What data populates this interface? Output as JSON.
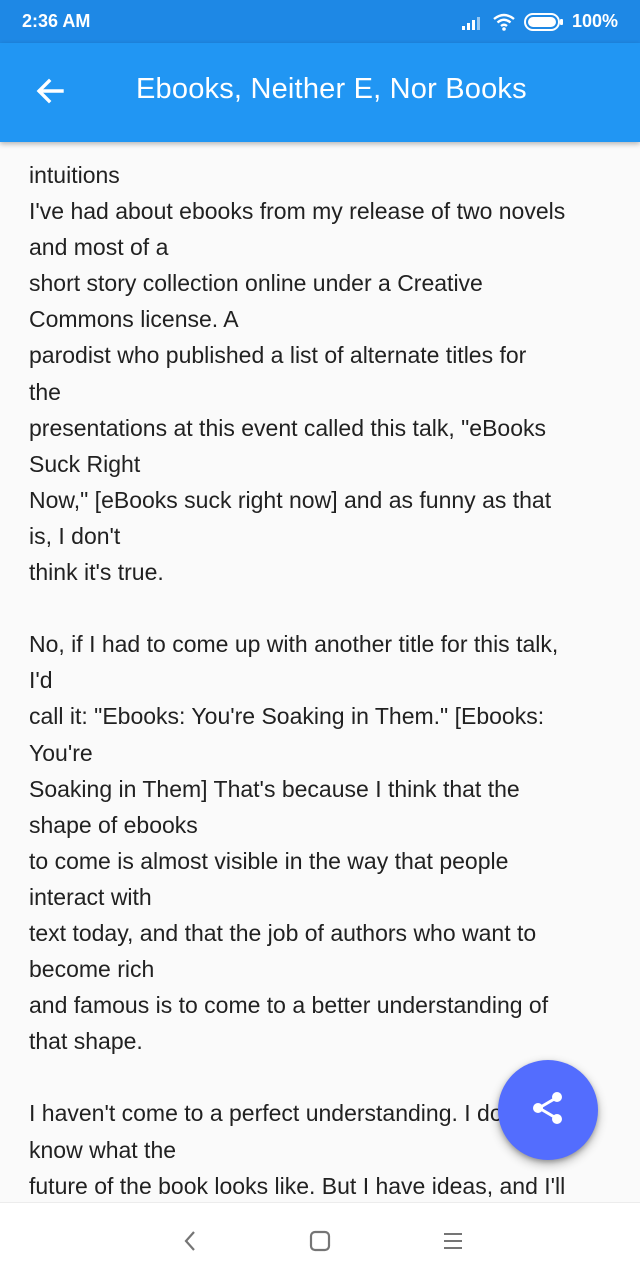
{
  "status_bar": {
    "time": "2:36 AM",
    "battery": "100%",
    "icons": [
      "signal-icon",
      "wifi-icon",
      "battery-icon"
    ]
  },
  "app_bar": {
    "title": "Ebooks, Neither E, Nor Books",
    "back_icon": "arrow-left-icon"
  },
  "article": {
    "lines": [
      "intuitions",
      "I've had about ebooks from my release of two novels",
      "and most of a",
      "short story collection online under a Creative",
      "Commons license. A",
      "parodist who published a list of alternate titles for",
      "the",
      "presentations at this event called this talk, \"eBooks",
      "Suck Right",
      "Now,\" [eBooks suck right now] and as funny as that",
      "is, I don't",
      "think it's true.",
      "",
      "No, if I had to come up with another title for this talk,",
      "I'd",
      "call it: \"Ebooks: You're Soaking in Them.\" [Ebooks:",
      "You're",
      "Soaking in Them] That's because I think that the",
      "shape of ebooks",
      "to come is almost visible in the way that people",
      "interact with",
      "text today, and that the job of authors who want to",
      "become rich",
      "and famous is to come to a better understanding of",
      "that shape.",
      "",
      "I haven't come to a perfect understanding. I don't",
      "know what the",
      "future of the book looks like. But I have ideas, and I'll"
    ]
  },
  "fab": {
    "icon": "share-icon"
  },
  "nav_bar": {
    "icons": [
      "back-triangle-icon",
      "home-square-icon",
      "menu-lines-icon"
    ]
  },
  "colors": {
    "status_bar": "#1e88e5",
    "app_bar": "#2196f3",
    "fab": "#536dfe",
    "background": "#fafafa",
    "text": "#212121"
  }
}
